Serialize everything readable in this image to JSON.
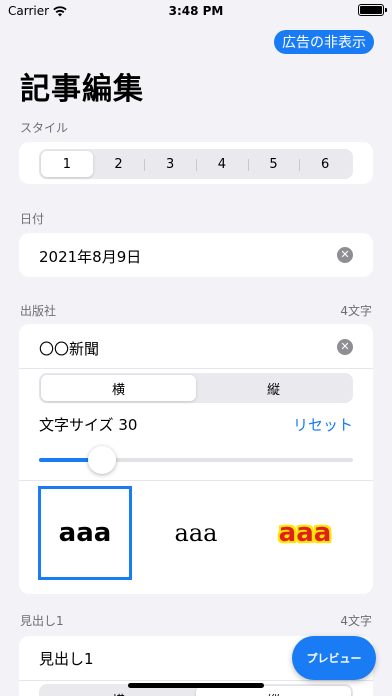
{
  "status": {
    "carrier": "Carrier",
    "time": "3:48 PM"
  },
  "ad_button": "広告の非表示",
  "title": "記事編集",
  "style_section": {
    "label": "スタイル",
    "options": [
      "1",
      "2",
      "3",
      "4",
      "5",
      "6"
    ],
    "selected": "1"
  },
  "date_section": {
    "label": "日付",
    "value": "2021年8月9日"
  },
  "publisher_section": {
    "label": "出版社",
    "count": "4文字",
    "value": "〇〇新聞",
    "orientation": {
      "options": [
        "横",
        "縦"
      ],
      "selected": "横"
    },
    "font_size_label": "文字サイズ 30",
    "reset": "リセット",
    "slider_fraction": 0.2,
    "font_samples": [
      "aaa",
      "aaa",
      "aaa"
    ],
    "selected_font": 0
  },
  "heading_section": {
    "label": "見出し1",
    "count": "4文字",
    "value": "見出し1",
    "orientation": {
      "options": [
        "横",
        "縦"
      ],
      "selected": "縦"
    }
  },
  "preview_button": "プレビュー",
  "colors": {
    "accent": "#1a7cf5",
    "background": "#f2f2f7"
  },
  "icons": [
    "wifi-icon",
    "battery-icon",
    "clear-icon"
  ]
}
